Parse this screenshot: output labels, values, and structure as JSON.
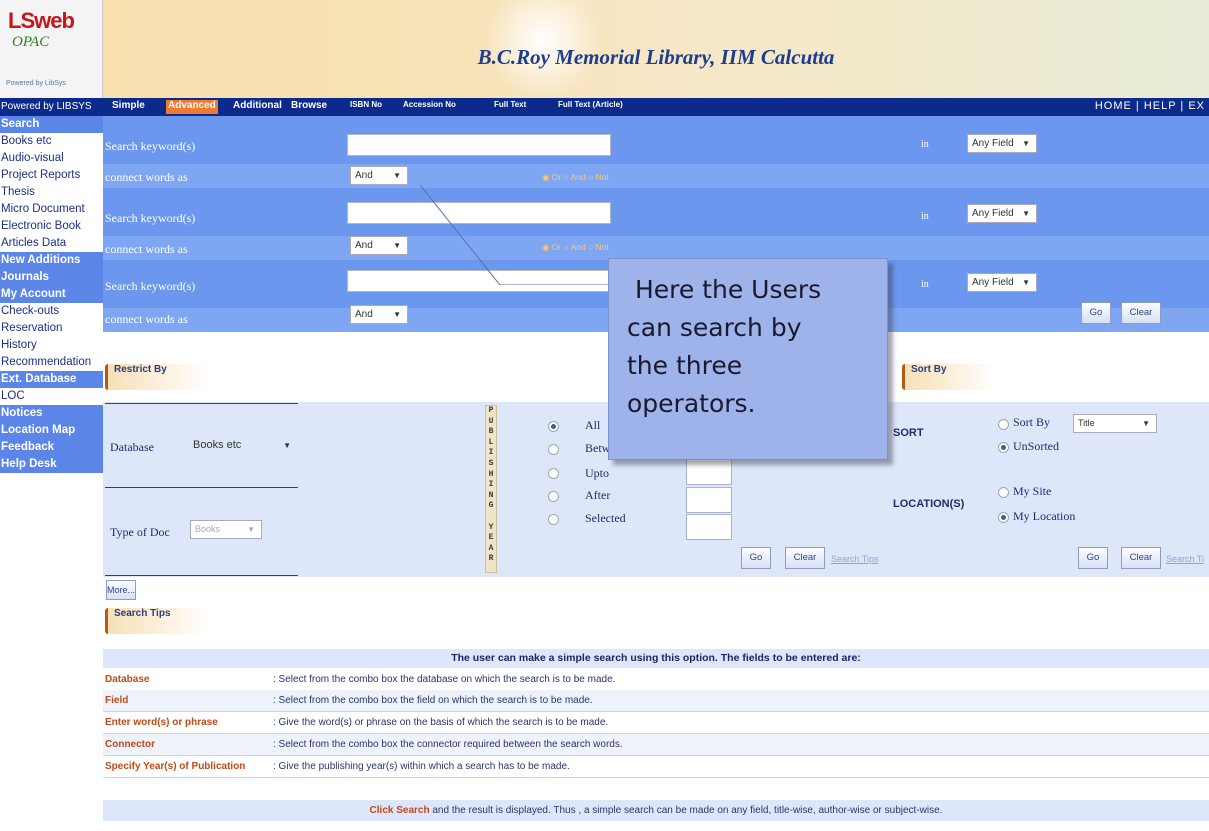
{
  "app": {
    "logo_line1": "LSweb",
    "logo_line2": "OPAC",
    "logo_powered": "Powered by LibSys",
    "title": "B.C.Roy Memorial Library, IIM Calcutta"
  },
  "nav": {
    "powered": "Powered by LIBSYS",
    "tabs": [
      "Simple",
      "Advanced",
      "Additional",
      "Browse",
      "ISBN No",
      "Accession No",
      "Full Text",
      "Full Text (Article)"
    ],
    "right": "HOME | HELP | EX"
  },
  "sidebar": {
    "items": [
      "Search",
      "Books etc",
      "Audio-visual",
      "Project Reports",
      "Thesis",
      "Micro Document",
      "Electronic Book",
      "Articles Data",
      "New Additions",
      "Journals",
      "My Account",
      "Check-outs",
      "Reservation",
      "History",
      "Recommendation",
      "Ext. Database",
      "LOC",
      "Notices",
      "Location Map",
      "Feedback",
      "Help Desk"
    ]
  },
  "search": {
    "keyword_label": "Search keyword(s)",
    "connect_label": "connect words as",
    "in_label": "in",
    "connector_value": "And",
    "field_value": "Any Field",
    "or_label": "Or",
    "and_label": "And",
    "not_label": "Not",
    "go": "Go",
    "clear": "Clear",
    "tips": "Search Tips"
  },
  "restrict": {
    "header": "Restrict By",
    "database_label": "Database",
    "database_value": "Books etc",
    "doctype_label": "Type of Doc",
    "doctype_value": "Books",
    "pub_year": "PUBLISHING YEAR",
    "year_opts": [
      "All",
      "Between",
      "Upto",
      "After",
      "Selected"
    ],
    "go": "Go",
    "clear": "Clear",
    "tips": "Search Tips",
    "more": "More..."
  },
  "sort": {
    "header": "Sort By",
    "sort_label": "SORT",
    "sort_by": "Sort By",
    "sort_field": "Title",
    "unsorted": "UnSorted",
    "location_label": "LOCATION(S)",
    "my_site": "My Site",
    "my_location": "My Location",
    "go": "Go",
    "clear": "Clear",
    "tips": "Search Ti"
  },
  "tips": {
    "header": "Search Tips",
    "intro": "The user can make a simple search using this option. The fields to be entered are:",
    "rows": [
      {
        "key": "Database",
        "val": ": Select from the combo box the database on which the search is to be made."
      },
      {
        "key": "Field",
        "val": ": Select from the combo box the field on which the search is to be made."
      },
      {
        "key": "Enter word(s) or phrase",
        "val": ": Give the word(s) or phrase on the basis of which the search is to be made."
      },
      {
        "key": "Connector",
        "val": ": Select from the combo box the connector required between the search words."
      },
      {
        "key": "Specify Year(s) of Publication",
        "val": ": Give the publishing year(s) within which a search has to be made."
      }
    ],
    "footer_link": "Click Search",
    "footer_rest": " and the result is displayed. Thus , a simple search can be made on any field, title-wise, author-wise or subject-wise."
  },
  "callout": {
    "line1": " Here the Users",
    "line2": "can search by",
    "line3": "the three",
    "line4": "operators."
  }
}
